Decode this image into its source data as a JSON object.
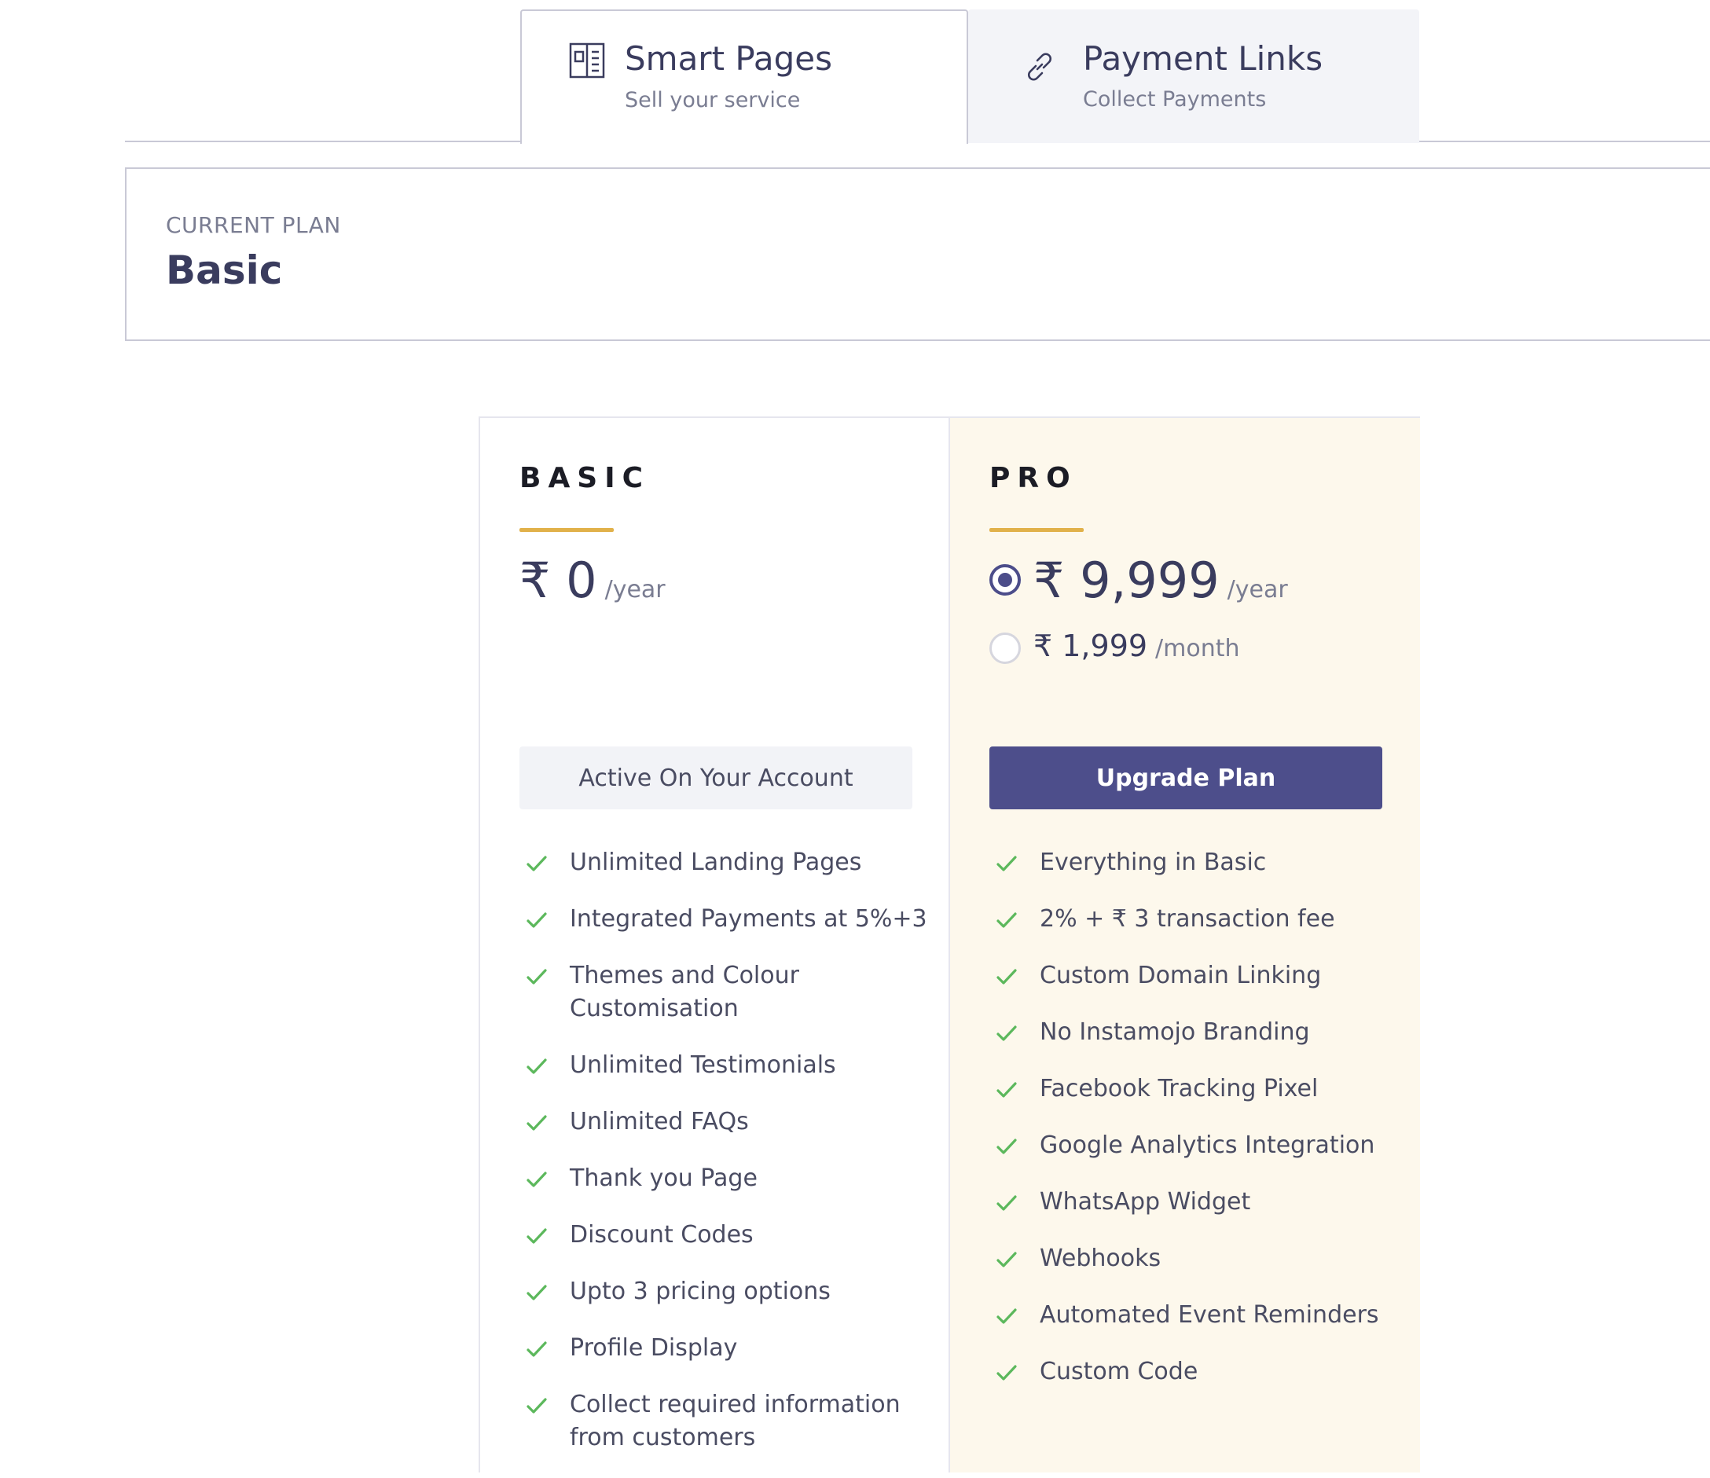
{
  "tabs": [
    {
      "title": "Smart Pages",
      "subtitle": "Sell your service",
      "icon": "layout-icon",
      "active": true
    },
    {
      "title": "Payment Links",
      "subtitle": "Collect Payments",
      "icon": "link-icon",
      "active": false
    }
  ],
  "current_plan": {
    "label": "CURRENT PLAN",
    "value": "Basic"
  },
  "plans": {
    "basic": {
      "name": "BASIC",
      "price": "₹ 0",
      "period": "/year",
      "button": "Active On Your Account",
      "features": [
        "Unlimited Landing Pages",
        "Integrated Payments at 5%+3",
        "Themes and Colour Customisation",
        "Unlimited Testimonials",
        "Unlimited FAQs",
        "Thank you Page",
        "Discount Codes",
        "Upto 3 pricing options",
        "Profile Display",
        "Collect required information from customers"
      ]
    },
    "pro": {
      "name": "PRO",
      "yearly_price": "₹ 9,999",
      "yearly_period": "/year",
      "monthly_price": "₹ 1,999",
      "monthly_period": "/month",
      "selected_option": "yearly",
      "button": "Upgrade Plan",
      "features": [
        "Everything in Basic",
        "2% + ₹ 3 transaction fee",
        "Custom Domain Linking",
        "No Instamojo Branding",
        "Facebook Tracking Pixel",
        "Google Analytics Integration",
        "WhatsApp Widget",
        "Webhooks",
        "Automated Event Reminders",
        "Custom Code"
      ]
    }
  },
  "colors": {
    "accent": "#4d4e8b",
    "underline": "#e1b14a",
    "check": "#5cb85c",
    "pro_background": "#fdf8ec"
  }
}
